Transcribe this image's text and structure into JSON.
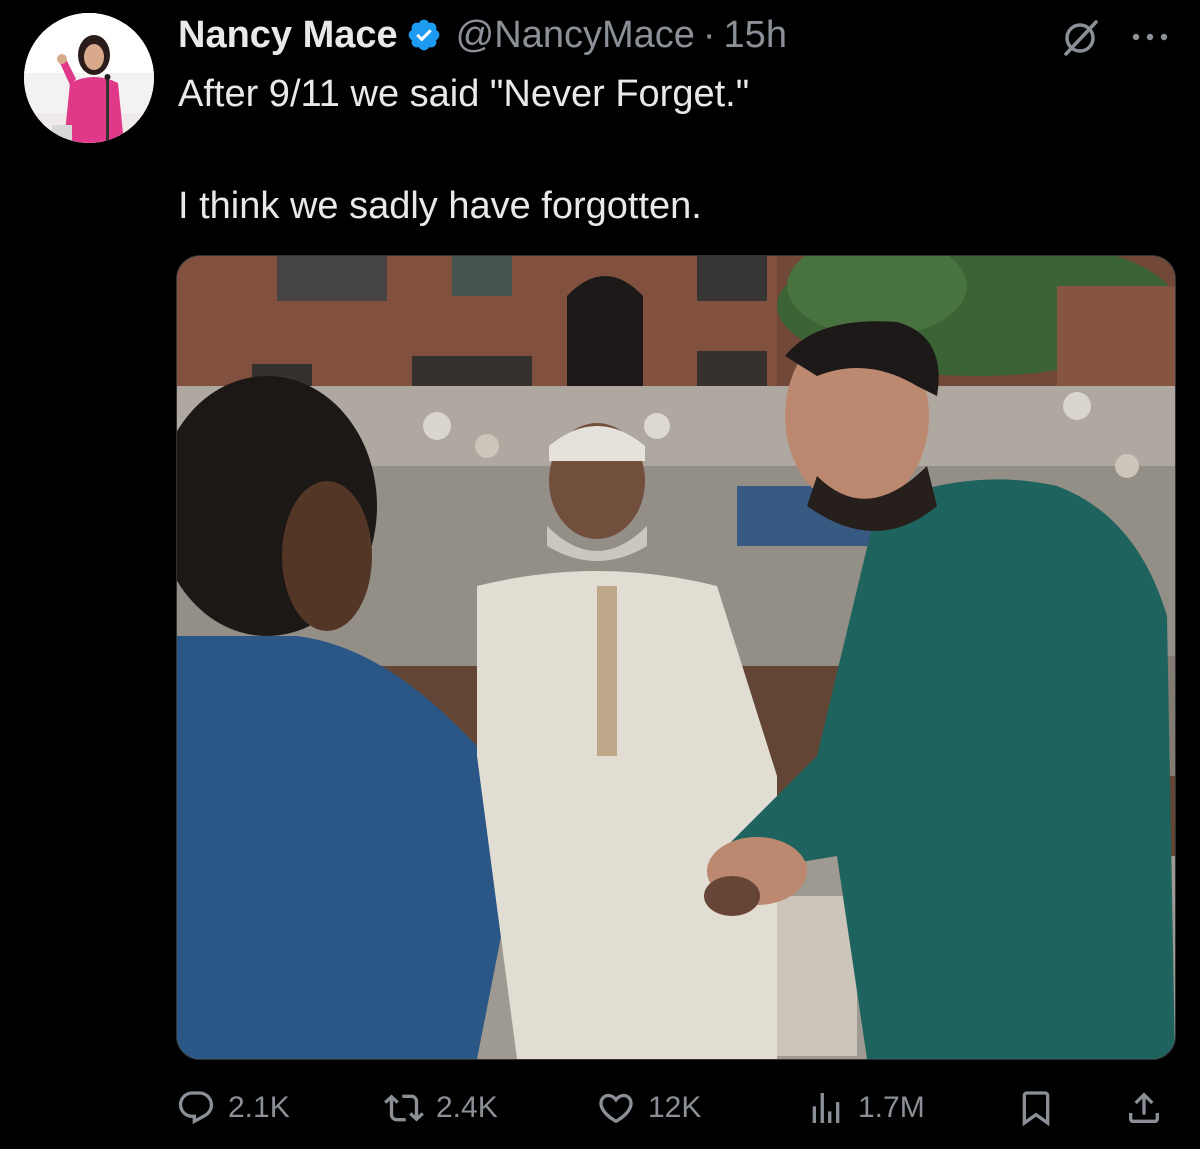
{
  "tweet": {
    "display_name": "Nancy Mace",
    "handle": "@NancyMace",
    "separator": "·",
    "time": "15h",
    "text_line1": "After 9/11 we said \"Never Forget.\"",
    "text_line2": "I think we sadly have forgotten."
  },
  "actions": {
    "replies": "2.1K",
    "reposts": "2.4K",
    "likes": "12K",
    "views": "1.7M"
  },
  "icons": {
    "verified": "verified-badge-icon",
    "grok": "grok-icon",
    "more": "more-icon",
    "reply": "reply-icon",
    "repost": "repost-icon",
    "like": "heart-icon",
    "views": "views-icon",
    "bookmark": "bookmark-icon",
    "share": "share-icon"
  },
  "colors": {
    "background": "#000000",
    "text_primary": "#e7e9ea",
    "text_secondary": "#8b9096",
    "verified": "#1d9bf0"
  }
}
